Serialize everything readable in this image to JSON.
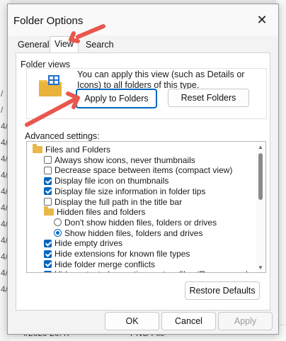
{
  "background": {
    "status_date": "4/2020 20:47",
    "status_type": "PNG File",
    "left_stubs": [
      "/",
      "/",
      "4/",
      "4/",
      "4/",
      "4/",
      "4/",
      "4/",
      "4/",
      "4/",
      "4/",
      "4/",
      "4/"
    ]
  },
  "dialog": {
    "title": "Folder Options",
    "close_glyph": "✕",
    "tabs": [
      {
        "label": "General",
        "active": false
      },
      {
        "label": "View",
        "active": true
      },
      {
        "label": "Search",
        "active": false
      }
    ],
    "folder_views": {
      "label": "Folder views",
      "description": "You can apply this view (such as Details or Icons) to all folders of this type.",
      "apply_button": "Apply to Folders",
      "reset_button": "Reset Folders"
    },
    "advanced": {
      "label": "Advanced settings:",
      "items": [
        {
          "type": "folder",
          "label": "Files and Folders",
          "indent": 0
        },
        {
          "type": "checkbox",
          "label": "Always show icons, never thumbnails",
          "checked": false,
          "indent": 1
        },
        {
          "type": "checkbox",
          "label": "Decrease space between items (compact view)",
          "checked": false,
          "indent": 1
        },
        {
          "type": "checkbox",
          "label": "Display file icon on thumbnails",
          "checked": true,
          "indent": 1
        },
        {
          "type": "checkbox",
          "label": "Display file size information in folder tips",
          "checked": true,
          "indent": 1
        },
        {
          "type": "checkbox",
          "label": "Display the full path in the title bar",
          "checked": false,
          "indent": 1
        },
        {
          "type": "folder",
          "label": "Hidden files and folders",
          "indent": 1
        },
        {
          "type": "radio",
          "label": "Don't show hidden files, folders or drives",
          "checked": false,
          "indent": 2
        },
        {
          "type": "radio",
          "label": "Show hidden files, folders and drives",
          "checked": true,
          "indent": 2
        },
        {
          "type": "checkbox",
          "label": "Hide empty drives",
          "checked": true,
          "indent": 1
        },
        {
          "type": "checkbox",
          "label": "Hide extensions for known file types",
          "checked": true,
          "indent": 1
        },
        {
          "type": "checkbox",
          "label": "Hide folder merge conflicts",
          "checked": true,
          "indent": 1
        },
        {
          "type": "checkbox",
          "label": "Hide protected operating system files (Recommended)",
          "checked": true,
          "indent": 1
        }
      ]
    },
    "restore_button": "Restore Defaults",
    "ok_button": "OK",
    "cancel_button": "Cancel",
    "apply_button": "Apply"
  },
  "colors": {
    "accent": "#0067c0",
    "arrow": "#e8574e"
  }
}
